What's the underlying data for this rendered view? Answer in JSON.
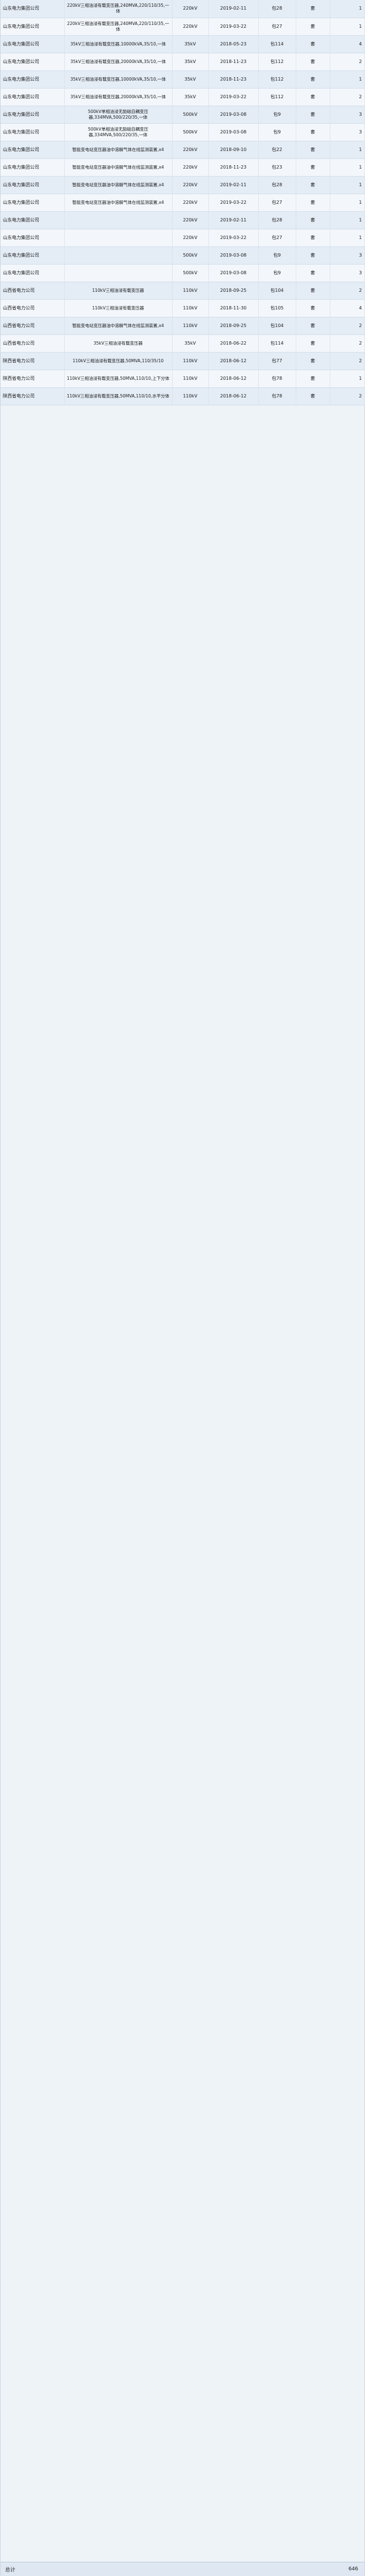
{
  "rows": [
    {
      "company": "山东电力集团公司",
      "desc": "220kV三相油浸有载变压器,240MVA,220/110/35,一体",
      "volt": "220kV",
      "date": "2019-02-11",
      "pkg": "包28",
      "unit": "套",
      "qty": "1"
    },
    {
      "company": "山东电力集团公司",
      "desc": "220kV三相油浸有载变压器,240MVA,220/110/35,一体",
      "volt": "220kV",
      "date": "2019-03-22",
      "pkg": "包27",
      "unit": "套",
      "qty": "1"
    },
    {
      "company": "山东电力集团公司",
      "desc": "35kV三相油浸有载变压器,10000kVA,35/10,一体",
      "volt": "35kV",
      "date": "2018-05-23",
      "pkg": "包114",
      "unit": "套",
      "qty": "4"
    },
    {
      "company": "山东电力集团公司",
      "desc": "35kV三相油浸有载变压器,20000kVA,35/10,一体",
      "volt": "35kV",
      "date": "2018-11-23",
      "pkg": "包112",
      "unit": "套",
      "qty": "2"
    },
    {
      "company": "山东电力集团公司",
      "desc": "35kV三相油浸有载变压器,10000kVA,35/10,一体",
      "volt": "35kV",
      "date": "2018-11-23",
      "pkg": "包112",
      "unit": "套",
      "qty": "1"
    },
    {
      "company": "山东电力集团公司",
      "desc": "35kV三相油浸有载变压器,20000kVA,35/10,一体",
      "volt": "35kV",
      "date": "2019-03-22",
      "pkg": "包112",
      "unit": "套",
      "qty": "2"
    },
    {
      "company": "山东电力集团公司",
      "desc": "500kV单相油浸无励磁自耦变压器,334MVA,500/220/35,一体",
      "volt": "500kV",
      "date": "2019-03-08",
      "pkg": "包9",
      "unit": "套",
      "qty": "3"
    },
    {
      "company": "山东电力集团公司",
      "desc": "500kV单相油浸无励磁自耦变压器,334MVA,500/220/35,一体",
      "volt": "500kV",
      "date": "2019-03-08",
      "pkg": "包9",
      "unit": "套",
      "qty": "3"
    },
    {
      "company": "山东电力集团公司",
      "desc": "智能变电站变压器油中溶解气体在线监测装置,x4",
      "volt": "220kV",
      "date": "2018-09-10",
      "pkg": "包22",
      "unit": "套",
      "qty": "1"
    },
    {
      "company": "山东电力集团公司",
      "desc": "智能变电站变压器油中溶解气体在线监测装置,x4",
      "volt": "220kV",
      "date": "2018-11-23",
      "pkg": "包23",
      "unit": "套",
      "qty": "1"
    },
    {
      "company": "山东电力集团公司",
      "desc": "智能变电站变压器油中溶解气体在线监测装置,x4",
      "volt": "220kV",
      "date": "2019-02-11",
      "pkg": "包28",
      "unit": "套",
      "qty": "1"
    },
    {
      "company": "山东电力集团公司",
      "desc": "智能变电站变压器油中溶解气体在线监测装置,x4",
      "volt": "220kV",
      "date": "2019-03-22",
      "pkg": "包27",
      "unit": "套",
      "qty": "1"
    },
    {
      "company": "山东电力集团公司",
      "desc": "",
      "volt": "220kV",
      "date": "2019-02-11",
      "pkg": "包28",
      "unit": "套",
      "qty": "1"
    },
    {
      "company": "山东电力集团公司",
      "desc": "",
      "volt": "220kV",
      "date": "2019-03-22",
      "pkg": "包27",
      "unit": "套",
      "qty": "1"
    },
    {
      "company": "山东电力集团公司",
      "desc": "",
      "volt": "500kV",
      "date": "2019-03-08",
      "pkg": "包9",
      "unit": "套",
      "qty": "3"
    },
    {
      "company": "山东电力集团公司",
      "desc": "",
      "volt": "500kV",
      "date": "2019-03-08",
      "pkg": "包9",
      "unit": "套",
      "qty": "3"
    },
    {
      "company": "山西省电力公司",
      "desc": "110kV三相油浸有载变压器",
      "volt": "110kV",
      "date": "2018-09-25",
      "pkg": "包104",
      "unit": "套",
      "qty": "2"
    },
    {
      "company": "山西省电力公司",
      "desc": "110kV三相油浸有载变压器",
      "volt": "110kV",
      "date": "2018-11-30",
      "pkg": "包105",
      "unit": "套",
      "qty": "4"
    },
    {
      "company": "山西省电力公司",
      "desc": "智能变电站变压器油中溶解气体在线监测装置,x4",
      "volt": "110kV",
      "date": "2018-09-25",
      "pkg": "包104",
      "unit": "套",
      "qty": "2"
    },
    {
      "company": "山西省电力公司",
      "desc": "35kV三相油浸有载变压器",
      "volt": "35kV",
      "date": "2018-06-22",
      "pkg": "包114",
      "unit": "套",
      "qty": "2"
    },
    {
      "company": "陕西省电力公司",
      "desc": "110kV三相油浸有载变压器,50MVA,110/35/10",
      "volt": "110kV",
      "date": "2018-06-12",
      "pkg": "包77",
      "unit": "套",
      "qty": "2"
    },
    {
      "company": "陕西省电力公司",
      "desc": "110kV三相油浸有载变压器,50MVA,110/10,上下分体",
      "volt": "110kV",
      "date": "2018-06-12",
      "pkg": "包78",
      "unit": "套",
      "qty": "1"
    },
    {
      "company": "陕西省电力公司",
      "desc": "110kV三相油浸有载变压器,50MVA,110/10,水平分体",
      "volt": "110kV",
      "date": "2018-06-12",
      "pkg": "包78",
      "unit": "套",
      "qty": "2"
    }
  ],
  "total": {
    "label": "总计",
    "value": "646"
  }
}
